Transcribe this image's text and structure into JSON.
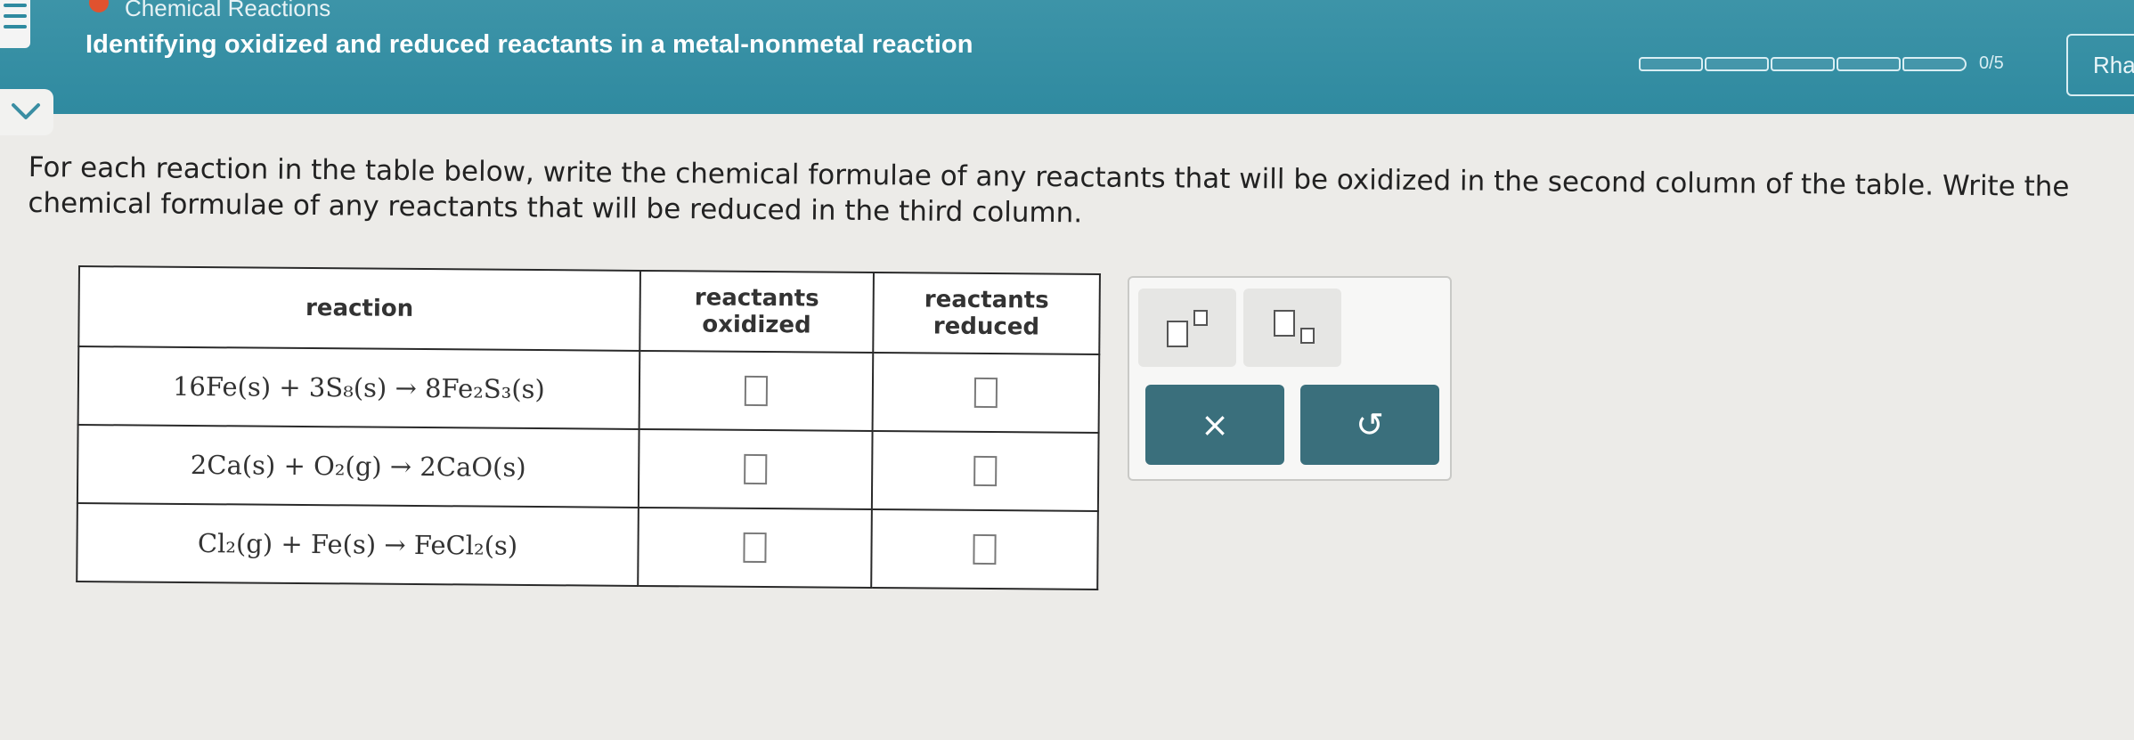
{
  "header": {
    "topic": "Chemical Reactions",
    "title": "Identifying oxidized and reduced reactants in a metal-nonmetal reaction",
    "progress_text": "0/5",
    "progress_value": 0,
    "progress_total": 5,
    "user_label": "Rha"
  },
  "instructions": "For each reaction in the table below, write the chemical formulae of any reactants that will be oxidized in the second column of the table. Write the chemical formulae of any reactants that will be reduced in the third column.",
  "table": {
    "headers": {
      "reaction": "reaction",
      "oxidized_line1": "reactants",
      "oxidized_line2": "oxidized",
      "reduced_line1": "reactants",
      "reduced_line2": "reduced"
    },
    "rows": [
      {
        "reaction": "16Fe(s) + 3S₈(s) → 8Fe₂S₃(s)",
        "oxidized": "",
        "reduced": ""
      },
      {
        "reaction": "2Ca(s) + O₂(g) → 2CaO(s)",
        "oxidized": "",
        "reduced": ""
      },
      {
        "reaction": "Cl₂(g) + Fe(s) → FeCl₂(s)",
        "oxidized": "",
        "reduced": ""
      }
    ]
  },
  "palette": {
    "clear_label": "×",
    "undo_label": "↺"
  },
  "icons": {
    "menu": "hamburger-icon",
    "collapse": "chevron-down-icon",
    "superscript": "superscript-icon",
    "subscript": "subscript-icon",
    "clear": "close-icon",
    "undo": "undo-icon"
  },
  "colors": {
    "header": "#2f8aa0",
    "action_button": "#3a6f7c",
    "topic_dot": "#e0522f"
  }
}
